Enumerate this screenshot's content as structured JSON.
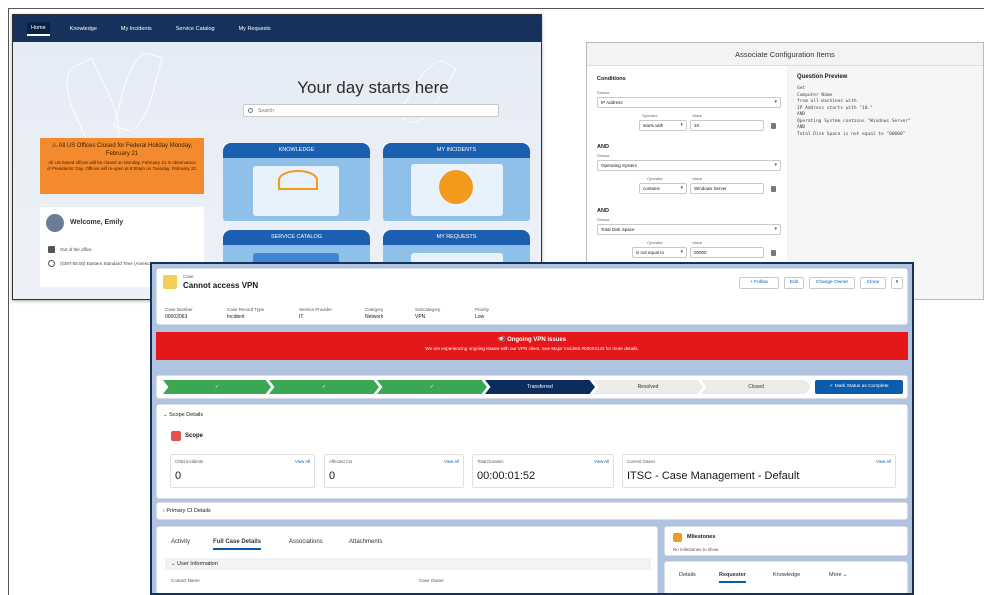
{
  "portal": {
    "nav": [
      "Home",
      "Knowledge",
      "My Incidents",
      "Service Catalog",
      "My Requests"
    ],
    "hero_title": "Your day starts here",
    "search_placeholder": "Search",
    "alert": {
      "title": "All US Offices Closed for Federal Holiday Monday, February 21",
      "body": "All US based offices will be closed on Monday, February 21 in observance of Presidents' Day. Offices will re-open at 8:00am on Tuesday, February 22."
    },
    "welcome": "Welcome, Emily",
    "status": "Out of the office",
    "timezone": "(GMT-05:00) Eastern Standard Time (America/New_York)",
    "tiles": [
      "KNOWLEDGE",
      "MY INCIDENTS",
      "SERVICE CATALOG",
      "MY REQUESTS"
    ]
  },
  "associate": {
    "title": "Associate Configuration Items",
    "conditions_label": "Conditions",
    "sensor_label": "Sensor",
    "operator_label": "Operator",
    "value_label": "Value",
    "and_label": "AND",
    "rows": [
      {
        "sensor": "IP Address",
        "operator": "starts with",
        "value": "10."
      },
      {
        "sensor": "Operating System",
        "operator": "contains",
        "value": "Windows Server"
      },
      {
        "sensor": "Total Disk Space",
        "operator": "is not equal to",
        "value": "00000"
      }
    ],
    "preview_title": "Question Preview",
    "preview_lines": [
      "Get",
      "  Computer Name",
      "from all machines with",
      "  IP Address starts with \"10.\"",
      "AND",
      "  Operating System contains \"Windows Server\"",
      "AND",
      "  Total Disk Space is not equal to \"00000\""
    ]
  },
  "case": {
    "object": "Case",
    "title": "Cannot access VPN",
    "actions": [
      "+ Follow",
      "Edit",
      "Change Owner",
      "Clone"
    ],
    "fields": [
      {
        "label": "Case Number",
        "value": "00002063"
      },
      {
        "label": "Case Record Type",
        "value": "Incident"
      },
      {
        "label": "Service Provider",
        "value": "IT"
      },
      {
        "label": "Category",
        "value": "Network"
      },
      {
        "label": "Subcategory",
        "value": "VPN"
      },
      {
        "label": "Priority",
        "value": "Low"
      }
    ],
    "banner": {
      "title": "Ongoing VPN issues",
      "body": "We are experiencing ongoing issues with our VPN client. See Major Incident #00004123 for more details."
    },
    "path": [
      "✓",
      "✓",
      "✓",
      "Transferred",
      "Resolved",
      "Closed"
    ],
    "path_current_index": 3,
    "mark_complete": "✓  Mark Status as Complete",
    "scope_details": "Scope Details",
    "scope": "Scope",
    "metrics": [
      {
        "label": "Child Incidents",
        "value": "0"
      },
      {
        "label": "Affected Cis",
        "value": "0"
      },
      {
        "label": "Total Duration",
        "value": "00:00:01:52"
      },
      {
        "label": "Current Owner",
        "value": "ITSC - Case Management - Default"
      }
    ],
    "view_all": "View All",
    "primary_ci": "Primary CI Details",
    "tabs": [
      "Activity",
      "Full Case Details",
      "Associations",
      "Attachments"
    ],
    "user_information": "User Information",
    "contact_name": "Contact Name",
    "case_owner": "Case Owner",
    "milestones": "Milestones",
    "no_milestones": "No milestones to show.",
    "right_tabs": [
      "Details",
      "Requester",
      "Knowledge",
      "More"
    ]
  },
  "colors": {
    "navy": "#16325c",
    "banner_red": "#e5171b",
    "path_green": "#3ba755",
    "brand_blue": "#0b5cab",
    "alert_orange": "#f38b2e"
  }
}
